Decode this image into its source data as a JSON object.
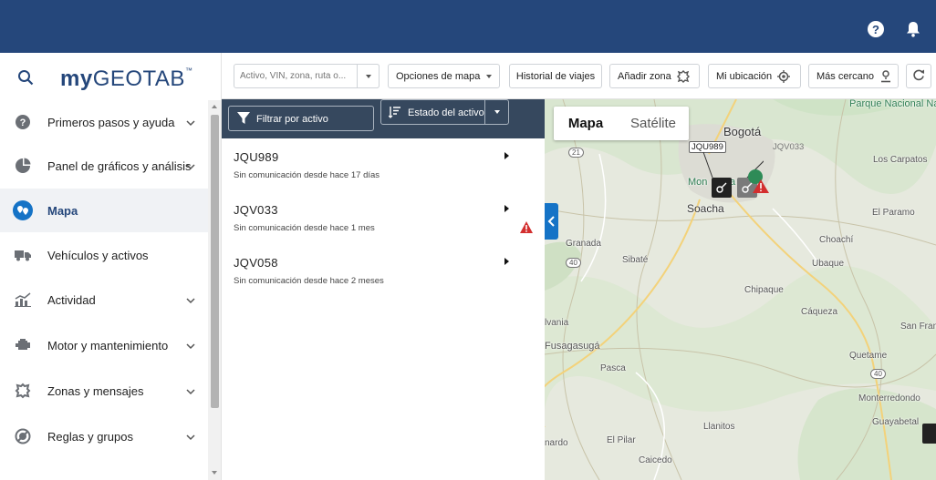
{
  "sidebar": {
    "logo": {
      "prefix": "my",
      "name": "GEOTAB",
      "mark": "™"
    },
    "items": [
      {
        "label": "Primeros pasos y ayuda",
        "icon": "help-circle-icon",
        "expandable": true,
        "active": false
      },
      {
        "label": "Panel de gráficos y análisis",
        "icon": "pie-chart-icon",
        "expandable": true,
        "active": false
      },
      {
        "label": "Mapa",
        "icon": "map-pin-icon",
        "expandable": false,
        "active": true
      },
      {
        "label": "Vehículos y activos",
        "icon": "truck-icon",
        "expandable": false,
        "active": false
      },
      {
        "label": "Actividad",
        "icon": "activity-chart-icon",
        "expandable": true,
        "active": false
      },
      {
        "label": "Motor y mantenimiento",
        "icon": "engine-icon",
        "expandable": true,
        "active": false
      },
      {
        "label": "Zonas y mensajes",
        "icon": "zones-icon",
        "expandable": true,
        "active": false
      },
      {
        "label": "Reglas y grupos",
        "icon": "rules-icon",
        "expandable": true,
        "active": false
      }
    ]
  },
  "toolbar": {
    "search_placeholder": "Activo, VIN, zona, ruta o...",
    "map_options": "Opciones de mapa",
    "trip_history": "Historial de viajes",
    "add_zone": "Añadir zona",
    "my_location": "Mi ubicación",
    "nearest": "Más cercano"
  },
  "panel": {
    "filter_label": "Filtrar por activo",
    "status_label": "Estado del activo",
    "assets": [
      {
        "name": "JQU989",
        "status": "Sin comunicación desde hace 17 días",
        "warning": false
      },
      {
        "name": "JQV033",
        "status": "Sin comunicación desde hace 1 mes",
        "warning": true
      },
      {
        "name": "JQV058",
        "status": "Sin comunicación desde hace 2 meses",
        "warning": false
      }
    ]
  },
  "map": {
    "tabs": {
      "map": "Mapa",
      "satellite": "Satélite"
    },
    "places": {
      "bogota": "Bogotá",
      "park": "Parque Nacional Natural Chingaza",
      "los_carpatos": "Los Carpatos",
      "soacha": "Soacha",
      "el_paramo": "El Paramo",
      "granada": "Granada",
      "sibate": "Sibaté",
      "choachi": "Choachí",
      "ubaque": "Ubaque",
      "chipaque": "Chipaque",
      "caqueza": "Cáqueza",
      "san_fran": "San Fran",
      "silvania": "lvania",
      "fusagasuga": "Fusagasugá",
      "pasca": "Pasca",
      "quetame": "Quetame",
      "monterredondo": "Monterredondo",
      "guayabetal": "Guayabetal",
      "llanitos": "Llanitos",
      "el_pilar": "El Pilar",
      "caicedo": "Caicedo",
      "nardo": "nardo",
      "mon": "Mon",
      "mon_tail": "a"
    },
    "routes": {
      "r21": "21",
      "r40a": "40",
      "r40b": "40"
    },
    "vehicle_labels": {
      "v1": "JQU989",
      "v2": "JQV033"
    }
  },
  "colors": {
    "topbar": "#25477b",
    "panel_header": "#36485e",
    "accent": "#1573c6",
    "warning": "#d32f2f"
  }
}
